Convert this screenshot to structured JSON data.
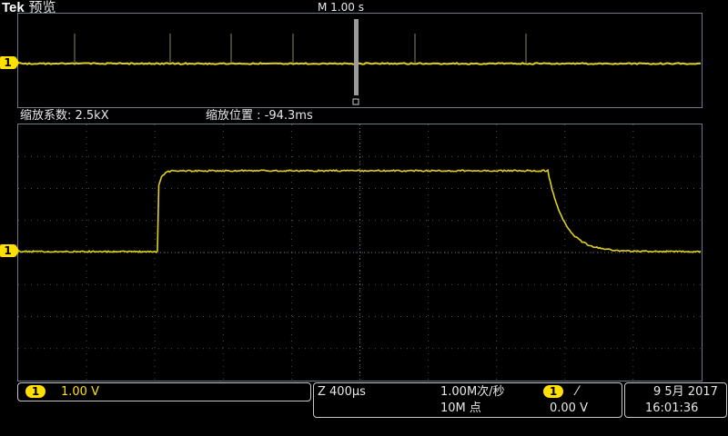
{
  "header": {
    "brand": "Tek",
    "mode": "预览",
    "horizontal_scale": "M 1.00 s"
  },
  "overview": {
    "channel_marker": "1"
  },
  "zoom": {
    "factor_label": "缩放系数: 2.5kX",
    "position_label": "缩放位置 : -94.3ms"
  },
  "main": {
    "channel_marker": "1"
  },
  "status_bar": {
    "channel": {
      "number": "1",
      "scale": "1.00 V"
    },
    "horizontal": {
      "zoom_scale": "Z 400µs",
      "sample_rate": "1.00M次/秒",
      "record_length": "10M 点",
      "trigger_channel": "1",
      "trigger_slope": "⁄",
      "trigger_level": "0.00 V"
    },
    "datetime": {
      "date": "9 5月 2017",
      "time": "16:01:36"
    }
  },
  "colors": {
    "trace": "#e0d020",
    "grid": "#4a5560",
    "trigger_marker": "#ff9a20",
    "channel1": "#ffe000"
  }
}
